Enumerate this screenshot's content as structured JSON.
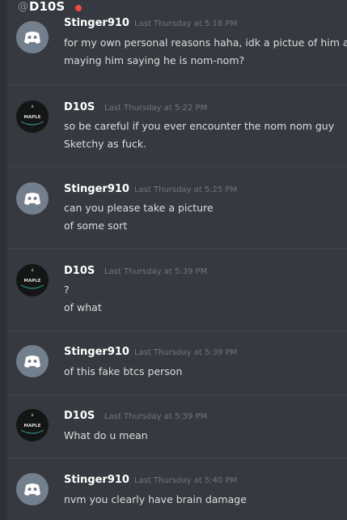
{
  "header": {
    "at": "@",
    "name": "D10S"
  },
  "messages": [
    {
      "author": "Stinger910",
      "timestamp": "Last Thursday at 5:18 PM",
      "avatar": "discord",
      "lines": [
        "for my own personal reasons haha, idk a pictue of him a",
        "maying him saying he is nom-nom?"
      ]
    },
    {
      "author": "D10S",
      "timestamp": "Last Thursday at 5:22 PM",
      "avatar": "maple",
      "avatar_text": "MAPLE",
      "lines": [
        "so be careful if you ever encounter the nom nom guy",
        "Sketchy as fuck."
      ]
    },
    {
      "author": "Stinger910",
      "timestamp": "Last Thursday at 5:25 PM",
      "avatar": "discord",
      "lines": [
        "can you please take a picture",
        "of some sort"
      ]
    },
    {
      "author": "D10S",
      "timestamp": "Last Thursday at 5:39 PM",
      "avatar": "maple",
      "avatar_text": "MAPLE",
      "lines": [
        "?",
        "of what"
      ]
    },
    {
      "author": "Stinger910",
      "timestamp": "Last Thursday at 5:39 PM",
      "avatar": "discord",
      "lines": [
        "of this fake btcs person"
      ]
    },
    {
      "author": "D10S",
      "timestamp": "Last Thursday at 5:39 PM",
      "avatar": "maple",
      "avatar_text": "MAPLE",
      "lines": [
        "What do u mean"
      ]
    },
    {
      "author": "Stinger910",
      "timestamp": "Last Thursday at 5:40 PM",
      "avatar": "discord",
      "lines": [
        "nvm you clearly have brain damage"
      ]
    }
  ],
  "colors": {
    "background": "#36393f",
    "status_dnd": "#f04747",
    "discord_avatar": "#747f8d"
  }
}
